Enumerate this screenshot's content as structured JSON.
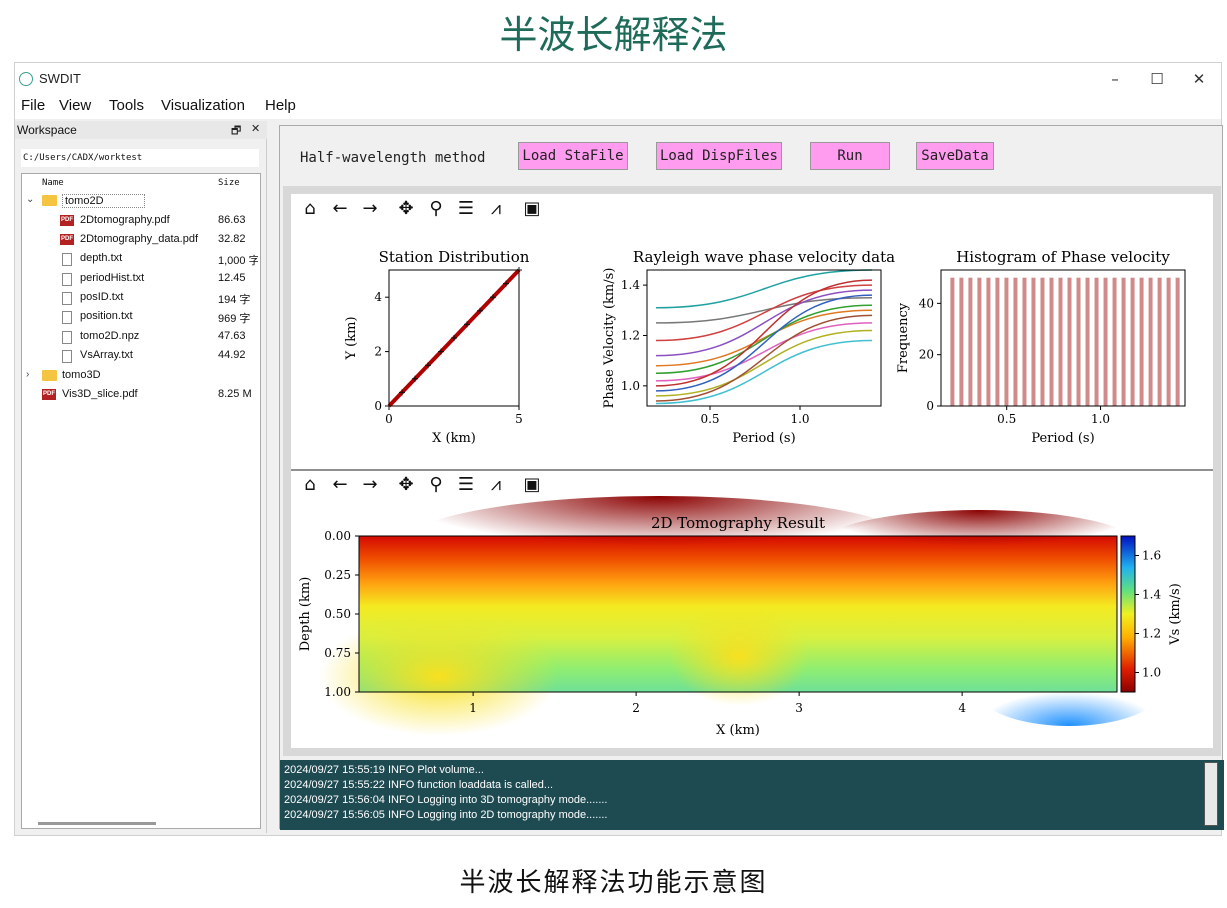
{
  "captions": {
    "top": "半波长解释法",
    "bottom": "半波长解释法功能示意图"
  },
  "window": {
    "title": "SWDIT",
    "controls": {
      "minimize": "–",
      "maximize": "☐",
      "close": "✕"
    }
  },
  "menu": [
    "File",
    "View",
    "Tools",
    "Visualization",
    "Help"
  ],
  "workspace": {
    "title": "Workspace",
    "float_btn": "🗗",
    "close_btn": "✕",
    "path": "C:/Users/CADX/worktest",
    "headers": {
      "name": "Name",
      "size": "Size"
    },
    "items": [
      {
        "name": "tomo2D",
        "size": "",
        "type": "folder",
        "expanded": true
      },
      {
        "name": "2Dtomography.pdf",
        "size": "86.63",
        "type": "pdf"
      },
      {
        "name": "2Dtomography_data.pdf",
        "size": "32.82",
        "type": "pdf"
      },
      {
        "name": "depth.txt",
        "size": "1,000 字",
        "type": "doc"
      },
      {
        "name": "periodHist.txt",
        "size": "12.45",
        "type": "doc"
      },
      {
        "name": "posID.txt",
        "size": "194 字",
        "type": "doc"
      },
      {
        "name": "position.txt",
        "size": "969 字",
        "type": "doc"
      },
      {
        "name": "tomo2D.npz",
        "size": "47.63",
        "type": "doc"
      },
      {
        "name": "VsArray.txt",
        "size": "44.92",
        "type": "doc"
      },
      {
        "name": "tomo3D",
        "size": "",
        "type": "folder",
        "expanded": false
      },
      {
        "name": "Vis3D_slice.pdf",
        "size": "8.25 M",
        "type": "pdf"
      }
    ]
  },
  "panel": {
    "method_label": "Half-wavelength method",
    "buttons": {
      "load_sta": "Load StaFile",
      "load_disp": "Load DispFiles",
      "run": "Run",
      "save": "SaveData"
    }
  },
  "toolbar_icons": [
    "home-icon",
    "back-icon",
    "forward-icon",
    "pan-icon",
    "zoom-icon",
    "configure-icon",
    "edit-curve-icon",
    "save-icon"
  ],
  "chart_data": [
    {
      "type": "scatter",
      "title": "Station Distribution",
      "xlabel": "X (km)",
      "ylabel": "Y (km)",
      "xlim": [
        0,
        5
      ],
      "ylim": [
        0,
        5
      ],
      "xticks": [
        0,
        5
      ],
      "yticks": [
        0,
        2,
        4
      ],
      "x": [
        0,
        0.5,
        1,
        1.5,
        2,
        2.5,
        3,
        3.5,
        4,
        4.5,
        5
      ],
      "y": [
        0,
        0.5,
        1,
        1.5,
        2,
        2.5,
        3,
        3.5,
        4,
        4.5,
        5
      ]
    },
    {
      "type": "line",
      "title": "Rayleigh wave phase velocity data",
      "xlabel": "Period (s)",
      "ylabel": "Phase Velocity (km/s)",
      "xlim": [
        0.2,
        1.4
      ],
      "ylim": [
        0.92,
        1.46
      ],
      "xticks": [
        0.5,
        1.0
      ],
      "yticks": [
        1.0,
        1.2,
        1.4
      ],
      "series": [
        {
          "values": [
            [
              0.2,
              1.31
            ],
            [
              1.4,
              1.46
            ]
          ],
          "color": "#20a0a0"
        },
        {
          "values": [
            [
              0.2,
              1.25
            ],
            [
              1.4,
              1.35
            ]
          ],
          "color": "#777777"
        },
        {
          "values": [
            [
              0.2,
              1.18
            ],
            [
              1.4,
              1.4
            ]
          ],
          "color": "#d04040"
        },
        {
          "values": [
            [
              0.2,
              1.12
            ],
            [
              1.4,
              1.38
            ]
          ],
          "color": "#8a4fc0"
        },
        {
          "values": [
            [
              0.2,
              1.08
            ],
            [
              1.4,
              1.3
            ]
          ],
          "color": "#e07820"
        },
        {
          "values": [
            [
              0.2,
              1.05
            ],
            [
              1.4,
              1.32
            ]
          ],
          "color": "#30a030"
        },
        {
          "values": [
            [
              0.2,
              1.02
            ],
            [
              1.4,
              1.25
            ]
          ],
          "color": "#e060c0"
        },
        {
          "values": [
            [
              0.2,
              0.98
            ],
            [
              1.4,
              1.36
            ]
          ],
          "color": "#3060c0"
        },
        {
          "values": [
            [
              0.2,
              0.96
            ],
            [
              1.4,
              1.22
            ]
          ],
          "color": "#b0b020"
        },
        {
          "values": [
            [
              0.2,
              0.94
            ],
            [
              1.4,
              1.28
            ]
          ],
          "color": "#a05030"
        },
        {
          "values": [
            [
              0.2,
              0.93
            ],
            [
              1.4,
              1.18
            ]
          ],
          "color": "#40c0d0"
        },
        {
          "values": [
            [
              0.2,
              1.0
            ],
            [
              1.4,
              1.42
            ]
          ],
          "color": "#c03030"
        }
      ]
    },
    {
      "type": "bar",
      "title": "Histogram of Phase velocity",
      "xlabel": "Period (s)",
      "ylabel": "Frequency",
      "xlim": [
        0.15,
        1.45
      ],
      "ylim": [
        0,
        50
      ],
      "xticks": [
        0.5,
        1.0
      ],
      "yticks": [
        0,
        20,
        40
      ],
      "bin_count": 26,
      "bin_value": 50,
      "bin_start": 0.2,
      "bin_step": 0.048
    },
    {
      "type": "heatmap",
      "title": "2D Tomography Result",
      "xlabel": "X (km)",
      "ylabel": "Depth (km)",
      "xlim": [
        0,
        5
      ],
      "ylim": [
        1.0,
        0.0
      ],
      "xticks": [
        1,
        2,
        3,
        4
      ],
      "yticks": [
        "0.00",
        "0.25",
        "0.50",
        "0.75",
        "1.00"
      ],
      "colorbar_label": "Vs (km/s)",
      "colorbar_ticks": [
        "1.6",
        "1.4",
        "1.2",
        "1.0"
      ],
      "vrange": [
        0.9,
        1.7
      ]
    }
  ],
  "log": [
    "2024/09/27 15:55:19 INFO Plot volume...",
    "2024/09/27 15:55:22 INFO function loaddata is called...",
    "2024/09/27 15:56:04 INFO Logging into 3D tomography mode.......",
    "2024/09/27 15:56:05 INFO Logging into 2D tomography mode......."
  ]
}
